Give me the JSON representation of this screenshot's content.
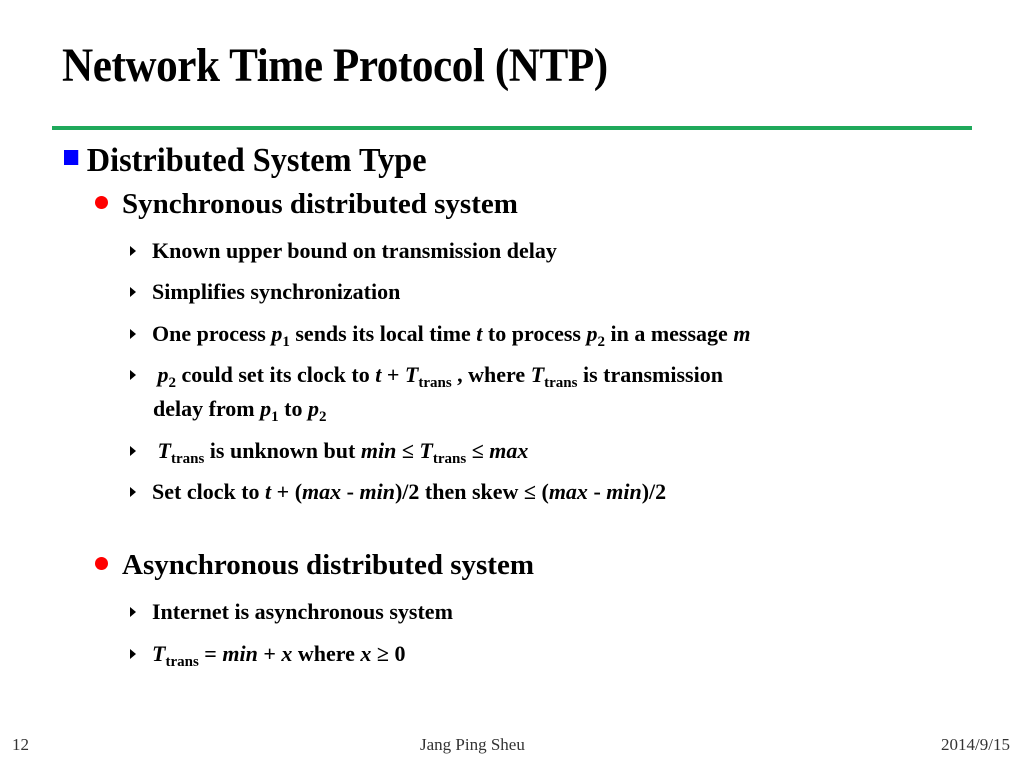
{
  "slide": {
    "title": "Network Time Protocol (NTP)",
    "accent_rule_color": "#1fa95b",
    "level1_bullet_color": "#0000ff",
    "level2_bullet_color": "#ff0000",
    "heading": "Distributed System Type",
    "sync": {
      "label": "Synchronous distributed system",
      "item1": "Known upper bound on transmission delay",
      "item2": "Simplifies synchronization",
      "item3": {
        "a": "One process ",
        "p": "p",
        "s1": "1",
        "b": " sends its local time ",
        "t": "t",
        "c": " to process ",
        "p2": "p",
        "s2": "2",
        "d": " in a message ",
        "m": "m"
      },
      "item4": {
        "p": "p",
        "s2": "2",
        "a": " could set its clock to ",
        "t": "t",
        "plus": " + ",
        "T": "T",
        "trans": "trans",
        "b": " , where ",
        "T2": "T",
        "trans2": "trans",
        "c": " is transmission",
        "d": "delay from ",
        "pa": "p",
        "sa": "1",
        "to": " to ",
        "pb": "p",
        "sb": "2"
      },
      "item5": {
        "T": "T",
        "trans": "trans",
        "a": " is unknown but ",
        "min": "min",
        "le1": " ≤ ",
        "T2": "T",
        "trans2": "trans",
        "le2": " ≤ ",
        "max": "max"
      },
      "item6": {
        "a": "Set clock to ",
        "t": "t",
        "b": " + (",
        "max": "max",
        "c": " - ",
        "min": "min",
        "d": ")/2 then skew ≤ (",
        "max2": "max",
        "e": " - ",
        "min2": "min",
        "f": ")/2"
      }
    },
    "async": {
      "label": "Asynchronous distributed system",
      "item1": "Internet is asynchronous system",
      "item2": {
        "T": "T",
        "trans": "trans",
        "eq": " = ",
        "min": "min",
        "plus": " + ",
        "x": "x",
        "a": " where ",
        "x2": "x",
        "ge": " ≥ 0"
      }
    }
  },
  "footer": {
    "page_number": "12",
    "author": "Jang Ping Sheu",
    "date": "2014/9/15"
  }
}
